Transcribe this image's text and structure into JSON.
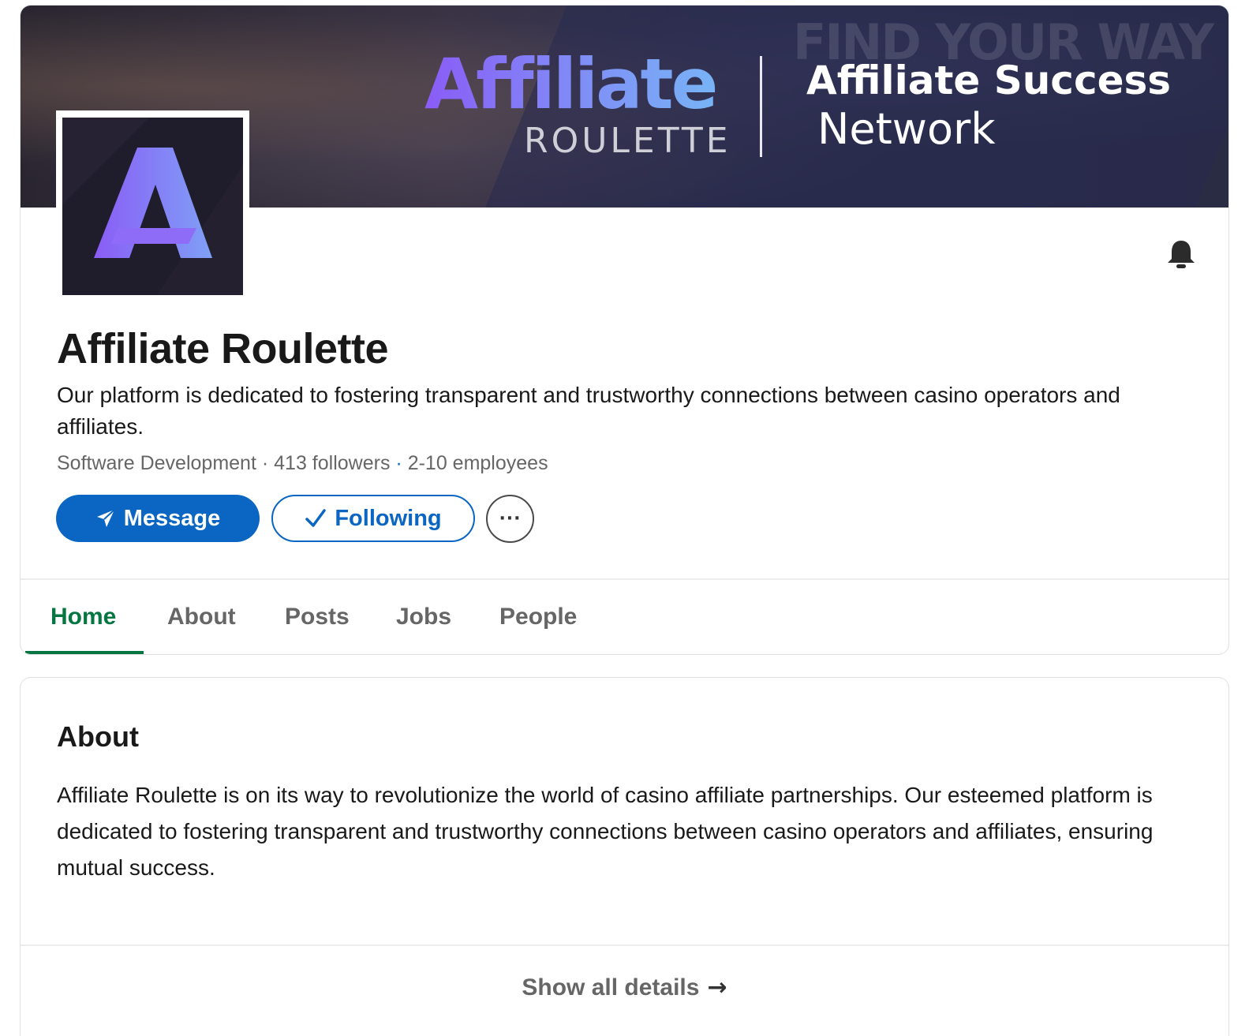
{
  "banner": {
    "logo_word": "Affiliate",
    "logo_sub": "ROULETTE",
    "title_line1": "Affiliate Success",
    "title_line2": "Network",
    "corner_text": "FIND YOUR WAY"
  },
  "company": {
    "name": "Affiliate Roulette",
    "tagline": "Our platform is dedicated to fostering transparent and trustworthy connections between casino operators and affiliates.",
    "industry": "Software Development",
    "followers": "413 followers",
    "employees": "2-10 employees",
    "separator": "·",
    "logo_icon": "letter-a-logo",
    "notification_icon": "bell-icon"
  },
  "actions": {
    "message_label": "Message",
    "following_label": "Following",
    "more_label": "···"
  },
  "tabs": [
    {
      "label": "Home",
      "active": true
    },
    {
      "label": "About",
      "active": false
    },
    {
      "label": "Posts",
      "active": false
    },
    {
      "label": "Jobs",
      "active": false
    },
    {
      "label": "People",
      "active": false
    }
  ],
  "about": {
    "heading": "About",
    "text": "Affiliate Roulette is on its way to revolutionize the world of casino affiliate partnerships. Our esteemed platform is dedicated to fostering transparent and trustworthy connections between casino operators and affiliates, ensuring mutual success.",
    "show_all_label": "Show all details",
    "show_all_arrow": "→"
  },
  "colors": {
    "primary_blue": "#0a66c2",
    "active_tab_green": "#057642",
    "logo_gradient_start": "#8a5cf6",
    "logo_gradient_end": "#78b4f6",
    "logo_bg": "#1f1c2b"
  }
}
